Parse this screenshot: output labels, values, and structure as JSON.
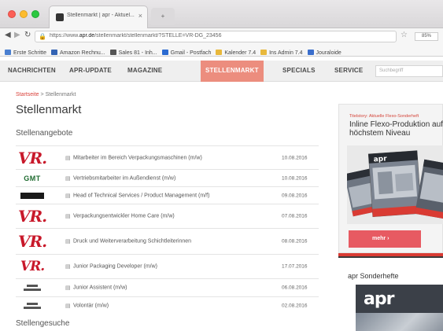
{
  "browser": {
    "tab_title": "Stellenmarkt | apr - Aktuel...",
    "tab_close": "×",
    "new_tab": "+",
    "url_prefix": "https://www.",
    "url_domain": "apr.de",
    "url_rest": "/stellenmarkt/stellenmarkt/?STELLE=VR-DG_23456",
    "zoom": "85%",
    "bookmarks": [
      {
        "label": "Erste Schritte",
        "color": "#4a7fd0"
      },
      {
        "label": "Amazon Rechnu...",
        "color": "#3464b4"
      },
      {
        "label": "Sales 81 - Inh...",
        "color": "#555555"
      },
      {
        "label": "Gmail - Postfach",
        "color": "#2c6bd1"
      },
      {
        "label": "Kalender 7.4",
        "color": "#e8b83c"
      },
      {
        "label": "Ins Admin 7.4",
        "color": "#e8b83c"
      },
      {
        "label": "Jouraloide",
        "color": "#3a6ecc"
      }
    ]
  },
  "nav": {
    "items": [
      {
        "label": "NACHRICHTEN",
        "active": false
      },
      {
        "label": "APR-UPDATE",
        "active": false
      },
      {
        "label": "MAGAZINE",
        "active": false
      },
      {
        "label": "STELLENMARKT",
        "active": true
      },
      {
        "label": "SPECIALS",
        "active": false
      },
      {
        "label": "SERVICE",
        "active": false
      }
    ],
    "search_placeholder": "Suchbegriff"
  },
  "breadcrumb": {
    "home": "Startseite",
    "sep": " > ",
    "current": "Stellenmarkt"
  },
  "page_title": "Stellenmarkt",
  "section_offers": "Stellenangebote",
  "jobs": [
    {
      "logo": "VR.",
      "logo_type": "vr",
      "title": "Mitarbeiter im Bereich Verpackungsmaschinen (m/w)",
      "date": "10.08.2016"
    },
    {
      "logo": "GMT",
      "logo_type": "gmt",
      "title": "Vertriebsmitarbeiter im Außendienst (m/w)",
      "date": "10.08.2016"
    },
    {
      "logo": "",
      "logo_type": "dark",
      "title": "Head of Technical Services / Product Management (m/f)",
      "date": "09.08.2016"
    },
    {
      "logo": "VR.",
      "logo_type": "vr",
      "title": "Verpackungsentwickler Home Care (m/w)",
      "date": "07.08.2016"
    },
    {
      "logo": "VR.",
      "logo_type": "vr",
      "title": "Druck und Weiterverarbeitung Schichtleiterinnen",
      "date": "08.08.2016"
    },
    {
      "logo": "VR.",
      "logo_type": "vr-sm",
      "title": "Junior Packaging Developer (m/w)",
      "date": "17.07.2016"
    },
    {
      "logo": "",
      "logo_type": "mini",
      "title": "Junior Assistent (m/w)",
      "date": "06.08.2016"
    },
    {
      "logo": "",
      "logo_type": "mini",
      "title": "Volontär (m/w)",
      "date": "02.08.2016"
    }
  ],
  "section_search": "Stellengesuche",
  "sidebar": {
    "ad_kicker": "Titelstory: Aktuelle Flexo-Sonderheft",
    "ad_headline": "Inline Flexo-Produktion auf höchstem Niveau",
    "ad_button": "mehr",
    "special_title": "apr Sonderhefte",
    "special_logo": "apr"
  }
}
